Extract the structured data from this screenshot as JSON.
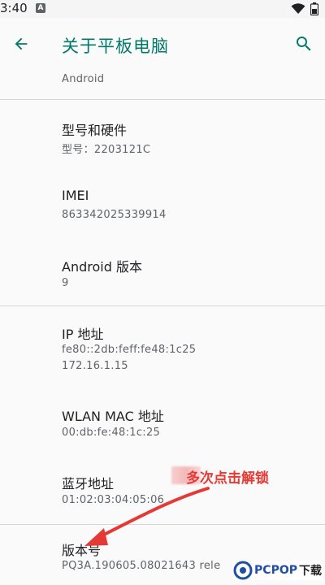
{
  "status_bar": {
    "time": "3:40",
    "notif_letter": "A"
  },
  "app_bar": {
    "title": "关于平板电脑"
  },
  "items": [
    {
      "title": "",
      "subtitle": "Android"
    },
    {
      "title": "型号和硬件",
      "subtitle": "型号：2203121C"
    },
    {
      "title": "IMEI",
      "subtitle": "863342025339914"
    },
    {
      "title": "Android 版本",
      "subtitle": "9"
    },
    {
      "title": "IP 地址",
      "subtitle": "fe80::2db:feff:fe48:1c25",
      "subtitle2": "172.16.1.15"
    },
    {
      "title": "WLAN MAC 地址",
      "subtitle": "00:db:fe:48:1c:25"
    },
    {
      "title": "蓝牙地址",
      "subtitle": "01:02:03:04:05:06"
    },
    {
      "title": "版本号",
      "subtitle": "PQ3A.190605.08021643 rele"
    }
  ],
  "annotation": {
    "text": "多次点击解锁",
    "color": "#e53935"
  },
  "watermark": {
    "brand": "PCPOP",
    "suffix": "下载"
  },
  "colors": {
    "accent": "#00796b",
    "annotation": "#e53935"
  }
}
